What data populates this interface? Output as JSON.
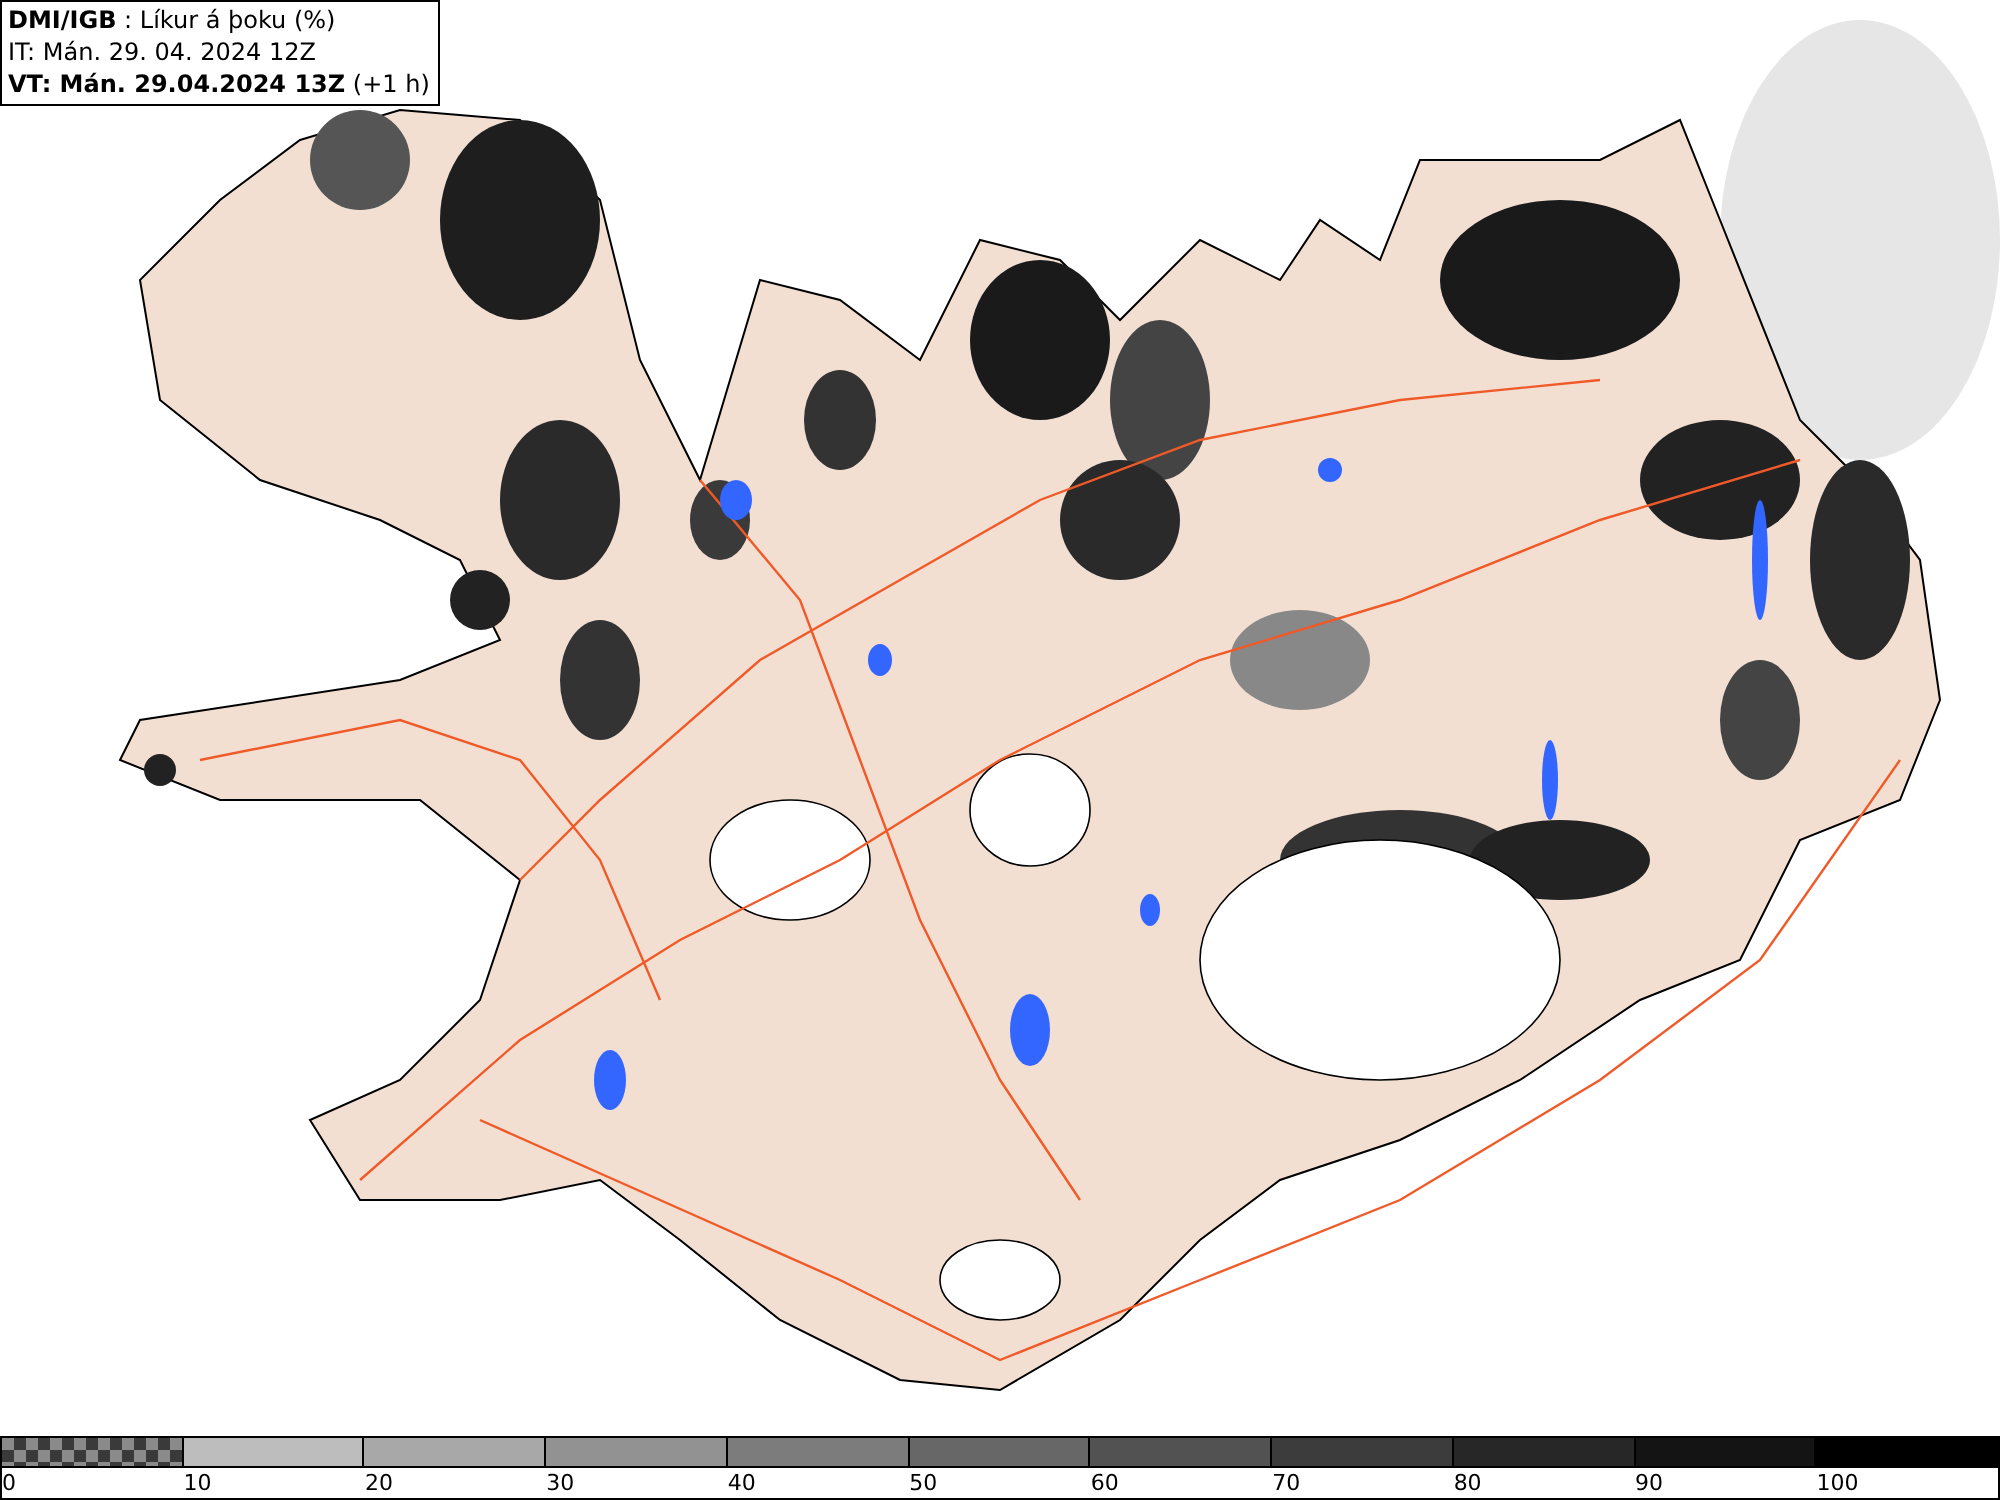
{
  "header": {
    "lines": [
      "**DMI/IGB** : Líkur á þoku (%)",
      "IT: Mán. 29. 04. 2024 12Z",
      "**VT: Mán. 29.04.2024 13Z** (+1 h)"
    ]
  },
  "legend": {
    "bins": [
      {
        "kind": "checker",
        "color": "#3a3a3a"
      },
      {
        "kind": "solid",
        "color": "#bdbdbd"
      },
      {
        "kind": "solid",
        "color": "#a8a8a8"
      },
      {
        "kind": "solid",
        "color": "#929292"
      },
      {
        "kind": "solid",
        "color": "#7c7c7c"
      },
      {
        "kind": "solid",
        "color": "#676767"
      },
      {
        "kind": "solid",
        "color": "#525252"
      },
      {
        "kind": "solid",
        "color": "#3c3c3c"
      },
      {
        "kind": "solid",
        "color": "#272727"
      },
      {
        "kind": "solid",
        "color": "#141414"
      },
      {
        "kind": "solid",
        "color": "#000000"
      }
    ],
    "labels": [
      "0",
      "10",
      "20",
      "30",
      "40",
      "50",
      "60",
      "70",
      "80",
      "90",
      "100"
    ]
  }
}
